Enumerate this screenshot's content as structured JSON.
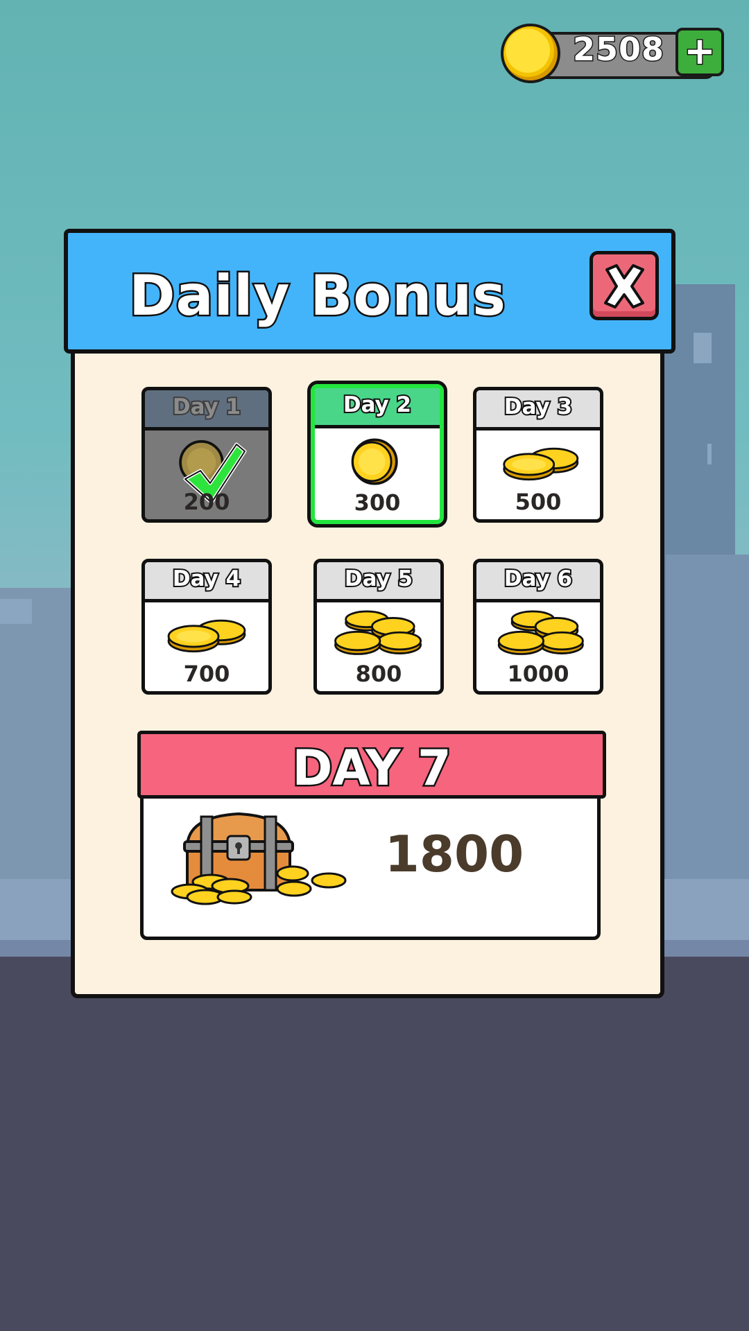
{
  "currency": {
    "amount": "2508",
    "add_icon": "plus-icon",
    "coin_icon": "coin-icon"
  },
  "dialog": {
    "title": "Daily Bonus",
    "close_icon": "close-icon",
    "days": [
      {
        "label": "Day 1",
        "amount": "200",
        "state": "claimed",
        "reward_icon": "single-coin-icon"
      },
      {
        "label": "Day 2",
        "amount": "300",
        "state": "today",
        "reward_icon": "single-coin-icon"
      },
      {
        "label": "Day 3",
        "amount": "500",
        "state": "locked",
        "reward_icon": "two-coins-icon"
      },
      {
        "label": "Day 4",
        "amount": "700",
        "state": "locked",
        "reward_icon": "two-coins-icon"
      },
      {
        "label": "Day 5",
        "amount": "800",
        "state": "locked",
        "reward_icon": "coin-pile-icon"
      },
      {
        "label": "Day 6",
        "amount": "1000",
        "state": "locked",
        "reward_icon": "coin-pile-icon"
      }
    ],
    "day7": {
      "label": "DAY 7",
      "amount": "1800",
      "reward_icon": "treasure-chest-icon"
    }
  },
  "colors": {
    "header": "#44b4fa",
    "close_button": "#ec6878",
    "today_highlight": "#22e63e",
    "today_head": "#49d688",
    "day7_banner": "#f6647e",
    "panel": "#fdf2e0"
  }
}
